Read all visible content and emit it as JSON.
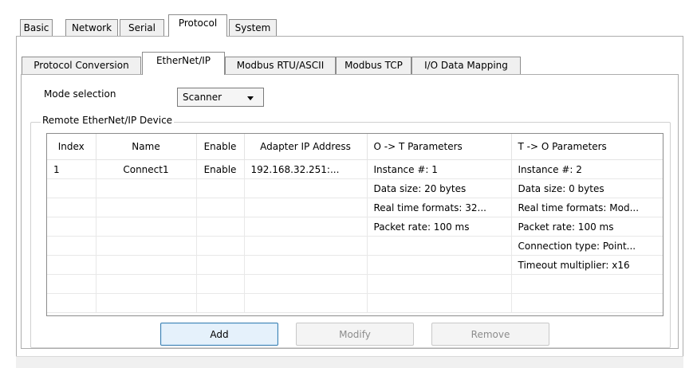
{
  "top_tabs": [
    "Basic",
    "Network",
    "Serial",
    "Protocol",
    "System"
  ],
  "top_active": "Protocol",
  "sub_tabs": [
    "Protocol Conversion",
    "EtherNet/IP",
    "Modbus RTU/ASCII",
    "Modbus TCP",
    "I/O Data Mapping"
  ],
  "sub_active": "EtherNet/IP",
  "mode": {
    "label": "Mode selection",
    "value": "Scanner",
    "dropdown_icon": "chevron-down-icon"
  },
  "group_title": "Remote EtherNet/IP Device",
  "table": {
    "columns": [
      "Index",
      "Name",
      "Enable",
      "Adapter IP Address",
      "O -> T Parameters",
      "T -> O Parameters"
    ],
    "rows": [
      [
        "1",
        "Connect1",
        "Enable",
        "192.168.32.251:...",
        "Instance  #: 1",
        "Instance  #: 2"
      ],
      [
        "",
        "",
        "",
        "",
        "Data size: 20 bytes",
        "Data size: 0 bytes"
      ],
      [
        "",
        "",
        "",
        "",
        "Real time formats: 32...",
        "Real time formats: Mod..."
      ],
      [
        "",
        "",
        "",
        "",
        "Packet rate: 100 ms",
        "Packet rate: 100 ms"
      ],
      [
        "",
        "",
        "",
        "",
        "",
        "Connection type: Point..."
      ],
      [
        "",
        "",
        "",
        "",
        "",
        "Timeout multiplier: x16"
      ],
      [
        "",
        "",
        "",
        "",
        "",
        ""
      ],
      [
        "",
        "",
        "",
        "",
        "",
        ""
      ]
    ]
  },
  "buttons": {
    "add": "Add",
    "modify": "Modify",
    "remove": "Remove"
  },
  "colors": {
    "primary_button_border": "#3c7fb1",
    "primary_button_bg": "#e5f1fb",
    "tab_inactive_bg": "#f0f0f0"
  }
}
